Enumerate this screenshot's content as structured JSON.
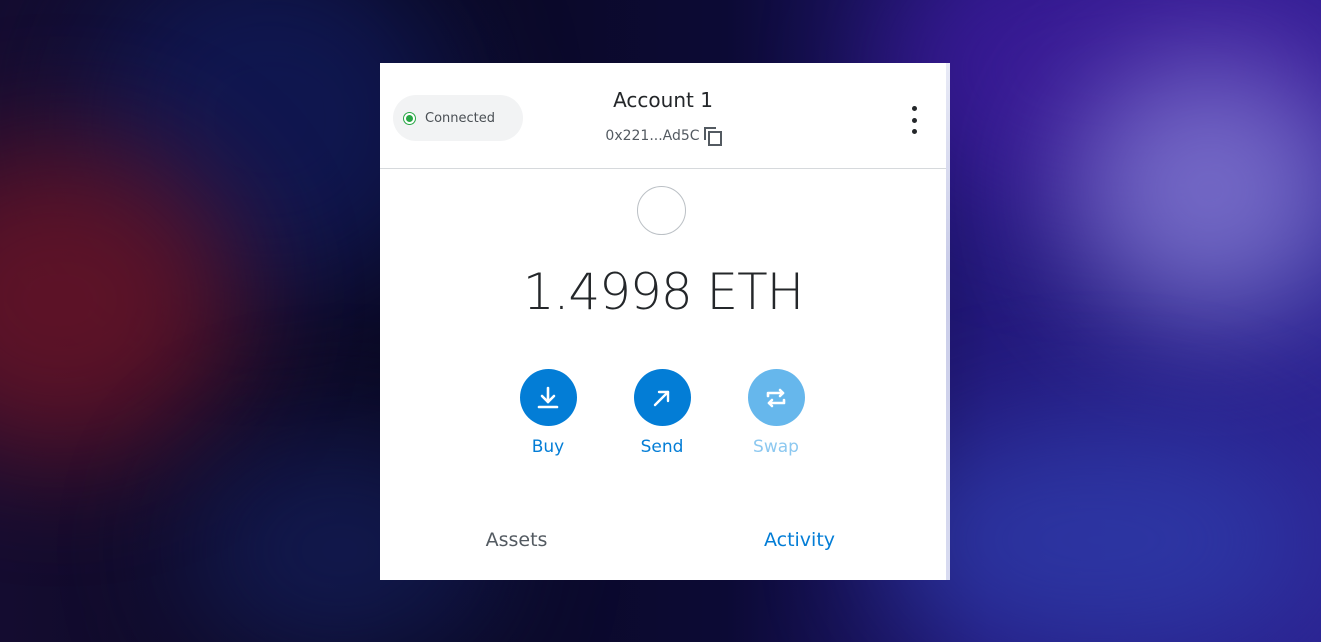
{
  "header": {
    "status_label": "Connected",
    "account_name": "Account 1",
    "address": "0x221...Ad5C"
  },
  "balance": {
    "amount": "1.4998 ETH"
  },
  "actions": [
    {
      "label": "Buy",
      "icon": "download-icon"
    },
    {
      "label": "Send",
      "icon": "arrow-up-right-icon"
    },
    {
      "label": "Swap",
      "icon": "swap-icon"
    }
  ],
  "tabs": [
    {
      "label": "Assets",
      "active": false
    },
    {
      "label": "Activity",
      "active": true
    }
  ],
  "colors": {
    "accent": "#037dd6",
    "accent_disabled": "#66b7ec",
    "connected_dot": "#28a745",
    "text_primary": "#24272a"
  }
}
